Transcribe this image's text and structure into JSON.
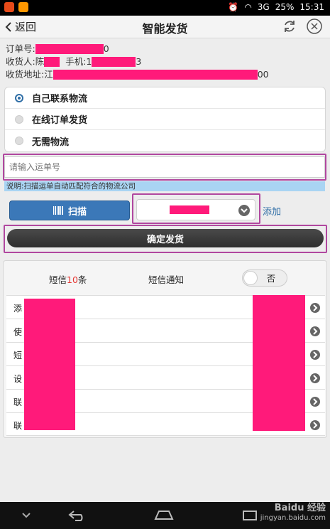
{
  "statusbar": {
    "signal": "3G",
    "battery": "25%",
    "time": "15:31"
  },
  "header": {
    "back_label": "返回",
    "title": "智能发货"
  },
  "order": {
    "order_label": "订单号:",
    "order_suffix": "0",
    "receiver_label": "收货人:陈",
    "phone_label": "手机:1",
    "phone_suffix": "3",
    "address_label": "收货地址:江",
    "address_suffix": "00"
  },
  "shipping_options": [
    {
      "label": "自己联系物流",
      "selected": true
    },
    {
      "label": "在线订单发货",
      "selected": false
    },
    {
      "label": "无需物流",
      "selected": false
    }
  ],
  "tracking_input": {
    "placeholder": "请输入运单号",
    "value": ""
  },
  "hint_text": "说明:扫描运单自动匹配符合的物流公司",
  "scan_button": {
    "label": "扫描",
    "icon": "barcode-icon"
  },
  "carrier_select": {
    "selected": ""
  },
  "add_link": "添加",
  "confirm_button": "确定发货",
  "sms": {
    "count_prefix": "短信",
    "count": "10",
    "count_suffix": "条",
    "notify_label": "短信通知",
    "toggle_label": "否"
  },
  "list_items": [
    {
      "label": "添"
    },
    {
      "label": "使"
    },
    {
      "label": "短"
    },
    {
      "label": "设"
    },
    {
      "label": "联"
    },
    {
      "label": "联"
    }
  ],
  "watermark": {
    "line1": "Baidu 经验",
    "line2": "jingyan.baidu.com"
  },
  "colors": {
    "accent": "#2f6ea6",
    "redaction": "#ff1a7a",
    "highlight": "#b0479f"
  }
}
